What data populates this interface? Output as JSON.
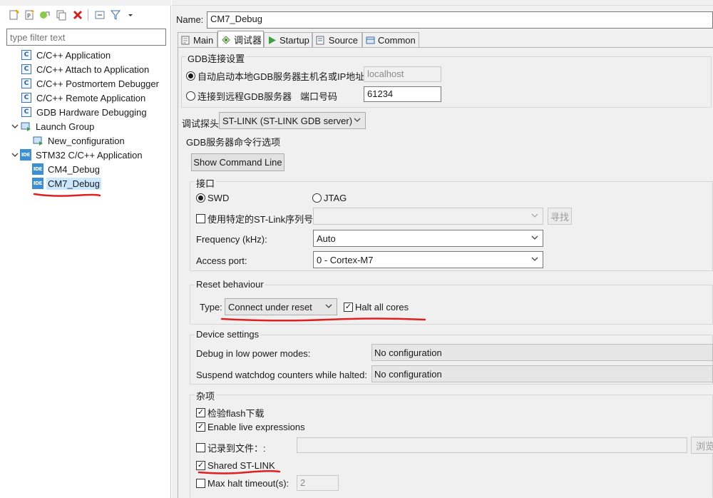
{
  "filter": {
    "placeholder": "type filter text"
  },
  "tree": [
    {
      "label": "C/C++ Application"
    },
    {
      "label": "C/C++ Attach to Application"
    },
    {
      "label": "C/C++ Postmortem Debugger"
    },
    {
      "label": "C/C++ Remote Application"
    },
    {
      "label": "GDB Hardware Debugging"
    },
    {
      "label": "Launch Group"
    },
    {
      "label": "New_configuration"
    },
    {
      "label": "STM32 C/C++ Application"
    },
    {
      "label": "CM4_Debug"
    },
    {
      "label": "CM7_Debug"
    }
  ],
  "icons": {
    "ide_badge": "IDE",
    "c_badge": "C"
  },
  "name": {
    "label": "Name:",
    "value": "CM7_Debug"
  },
  "tabs": [
    {
      "label": "Main"
    },
    {
      "label": "调试器"
    },
    {
      "label": "Startup"
    },
    {
      "label": "Source"
    },
    {
      "label": "Common"
    }
  ],
  "gdb_conn": {
    "title": "GDB连接设置",
    "local_label": "自动启动本地GDB服务器",
    "remote_label": "连接到远程GDB服务器",
    "host_label": "主机名或IP地址",
    "host_value": "localhost",
    "port_label": "端口号码",
    "port_value": "61234"
  },
  "probe": {
    "label": "调试探头",
    "value": "ST-LINK (ST-LINK GDB server)"
  },
  "gdb_cmd": {
    "title": "GDB服务器命令行选项",
    "show_cmd_btn": "Show Command Line"
  },
  "interface": {
    "title": "接口",
    "swd": "SWD",
    "jtag": "JTAG",
    "use_serial": "使用特定的ST-Link序列号",
    "find_btn": "寻找",
    "freq_label": "Frequency (kHz):",
    "freq_value": "Auto",
    "access_label": "Access port:",
    "access_value": "0 - Cortex-M7"
  },
  "reset": {
    "title": "Reset behaviour",
    "type_label": "Type:",
    "type_value": "Connect under reset",
    "halt_all": "Halt all cores"
  },
  "device": {
    "title": "Device settings",
    "low_power_label": "Debug in low power modes:",
    "low_power_value": "No configuration",
    "watchdog_label": "Suspend watchdog counters while halted:",
    "watchdog_value": "No configuration"
  },
  "misc": {
    "title": "杂项",
    "verify_flash": "检验flash下载",
    "live_expr": "Enable live expressions",
    "log_file": "记录到文件：:",
    "browse_btn": "浏览",
    "shared_stlink": "Shared ST-LINK",
    "max_halt_label": "Max halt timeout(s):",
    "max_halt_value": "2"
  },
  "colors": {
    "selection": "#cce8ff",
    "annotation": "#e02020",
    "ide_blue": "#3c8fd6"
  }
}
